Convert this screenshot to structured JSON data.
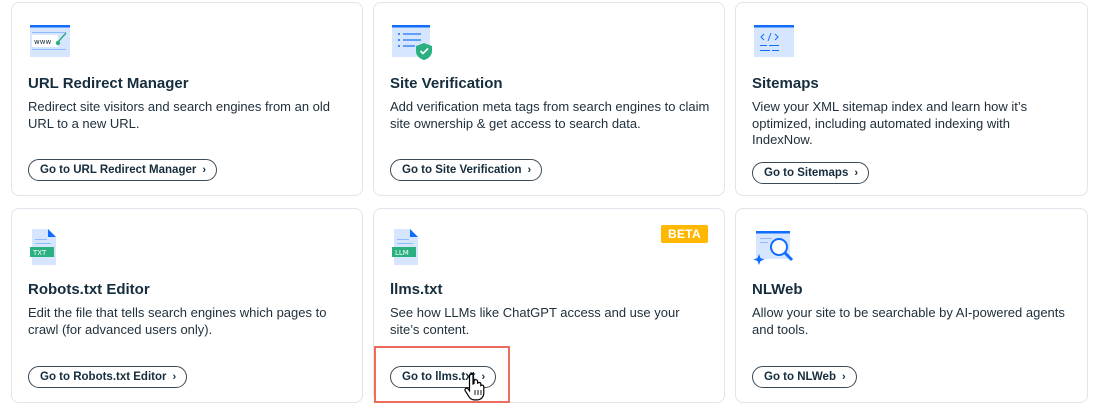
{
  "cards": [
    {
      "title": "URL Redirect Manager",
      "description": "Redirect site visitors and search engines from an old URL to a new URL.",
      "button": "Go to URL Redirect Manager",
      "icon": "url-redirect-icon"
    },
    {
      "title": "Site Verification",
      "description": "Add verification meta tags from search engines to claim site ownership & get access to search data.",
      "button": "Go to Site Verification",
      "icon": "site-verification-icon"
    },
    {
      "title": "Sitemaps",
      "description": "View your XML sitemap index and learn how it’s optimized, including automated indexing with IndexNow.",
      "button": "Go to Sitemaps",
      "icon": "sitemap-icon"
    },
    {
      "title": "Robots.txt Editor",
      "description": "Edit the file that tells search engines which pages to crawl (for advanced users only).",
      "button": "Go to Robots.txt Editor",
      "icon": "txt-file-icon",
      "icon_label": "TXT"
    },
    {
      "title": "llms.txt",
      "description": "See how LLMs like ChatGPT access and use your site’s content.",
      "button": "Go to llms.txt",
      "icon": "llm-file-icon",
      "icon_label": "LLM",
      "badge": "BETA"
    },
    {
      "title": "NLWeb",
      "description": "Allow your site to be searchable by AI-powered agents and tools.",
      "button": "Go to NLWeb",
      "icon": "nlweb-search-icon"
    }
  ],
  "url_icon_text": "www",
  "chevron": "›",
  "colors": {
    "accent": "#116dff",
    "light_blue": "#d6e6fe",
    "green": "#2bb07f",
    "beta": "#ffb700",
    "highlight": "#ee6c5c"
  }
}
